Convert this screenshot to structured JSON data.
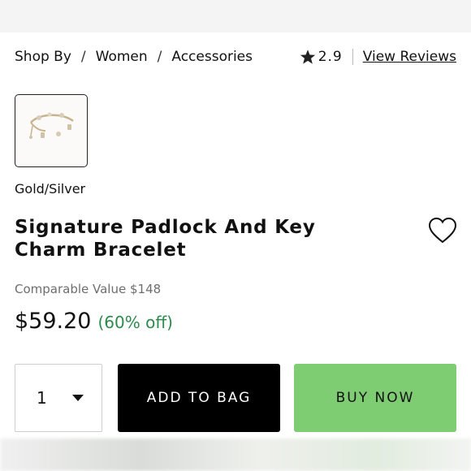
{
  "breadcrumb": {
    "items": [
      "Shop By",
      "Women",
      "Accessories"
    ],
    "separator": "/"
  },
  "rating": {
    "score": "2.9",
    "reviews_link": "View Reviews",
    "icon": "star-icon"
  },
  "product": {
    "color": "Gold/Silver",
    "title_line1": "Signature Padlock And Key",
    "title_line2": "Charm Bracelet",
    "comparable_value": "Comparable Value $148",
    "price": "$59.20",
    "discount": "(60% off)"
  },
  "purchase": {
    "quantity": "1",
    "add_to_bag_label": "ADD TO BAG",
    "buy_now_label": "BUY NOW"
  },
  "colors": {
    "discount_green": "#2c8a4c",
    "buy_now_bg": "#7fcd73",
    "add_to_bag_bg": "#000000"
  }
}
